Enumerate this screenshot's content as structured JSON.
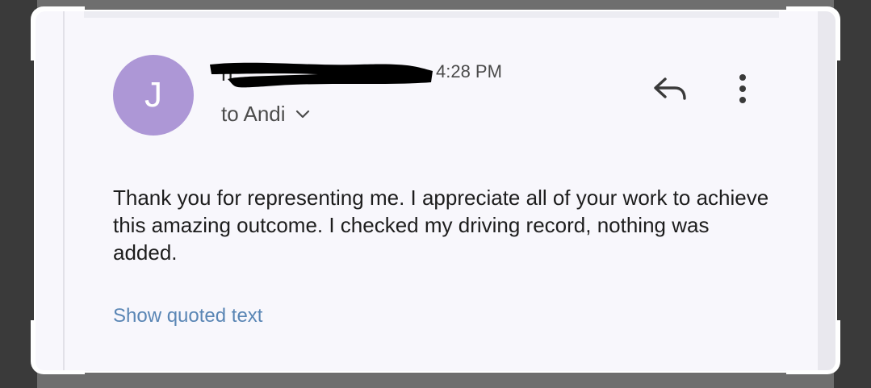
{
  "email": {
    "avatar_initial": "J",
    "sender_name": "n",
    "time": "4:28 PM",
    "recipient": "to Andi",
    "body": "Thank you for representing me. I appreciate all of your work to achieve this amazing outcome. I checked my driving record, nothing was added.",
    "show_quoted_label": "Show quoted text"
  },
  "icons": {
    "reply": "reply-icon",
    "more": "more-vert-icon",
    "expand": "chevron-down-icon"
  },
  "colors": {
    "avatar_bg": "#ad97d6",
    "card_bg": "#f8f7fc",
    "link": "#5a86b5",
    "redaction": "#000000"
  }
}
